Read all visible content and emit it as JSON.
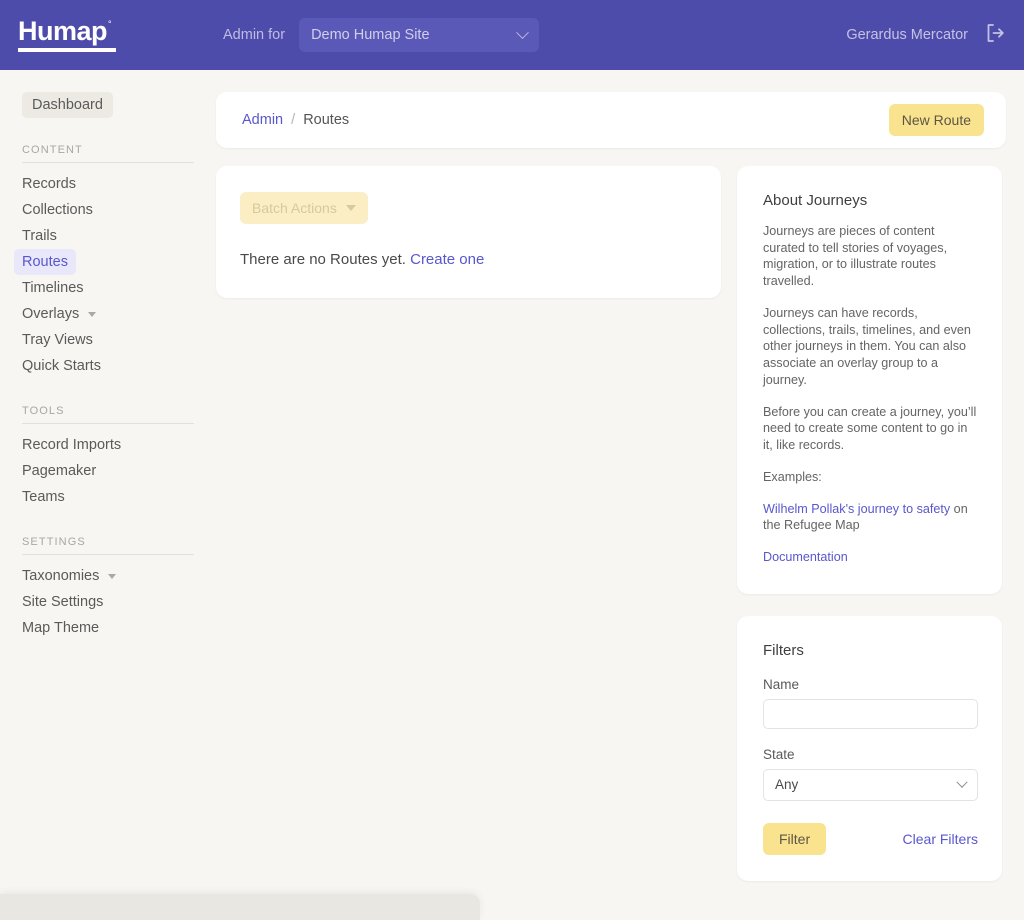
{
  "header": {
    "logo_text": "Humap",
    "logo_mark": "°",
    "admin_for_label": "Admin for",
    "site_value": "Demo Humap Site",
    "user_name": "Gerardus Mercator",
    "logout_icon": "sign-out-icon",
    "brand_color": "#4e4cab"
  },
  "sidebar": {
    "dashboard_label": "Dashboard",
    "groups": [
      {
        "label": "CONTENT",
        "items": [
          {
            "label": "Records",
            "active": false,
            "caret": false
          },
          {
            "label": "Collections",
            "active": false,
            "caret": false
          },
          {
            "label": "Trails",
            "active": false,
            "caret": false
          },
          {
            "label": "Routes",
            "active": true,
            "caret": false
          },
          {
            "label": "Timelines",
            "active": false,
            "caret": false
          },
          {
            "label": "Overlays",
            "active": false,
            "caret": true
          },
          {
            "label": "Tray Views",
            "active": false,
            "caret": false
          },
          {
            "label": "Quick Starts",
            "active": false,
            "caret": false
          }
        ]
      },
      {
        "label": "TOOLS",
        "items": [
          {
            "label": "Record Imports",
            "active": false,
            "caret": false
          },
          {
            "label": "Pagemaker",
            "active": false,
            "caret": false
          },
          {
            "label": "Teams",
            "active": false,
            "caret": false
          }
        ]
      },
      {
        "label": "SETTINGS",
        "items": [
          {
            "label": "Taxonomies",
            "active": false,
            "caret": true
          },
          {
            "label": "Site Settings",
            "active": false,
            "caret": false
          },
          {
            "label": "Map Theme",
            "active": false,
            "caret": false
          }
        ]
      }
    ]
  },
  "breadcrumb": {
    "root_label": "Admin",
    "separator": "/",
    "current_label": "Routes",
    "new_button_label": "New Route"
  },
  "list_panel": {
    "batch_actions_label": "Batch Actions",
    "empty_text": "There are no Routes yet.",
    "empty_link": "Create one"
  },
  "about_panel": {
    "title": "About Journeys",
    "paragraph_1": "Journeys are pieces of content curated to tell stories of voyages, migration, or to illustrate routes travelled.",
    "paragraph_2": "Journeys can have records, collections, trails, timelines, and even other journeys in them. You can also associate an overlay group to a journey.",
    "paragraph_3": "Before you can create a journey, you’ll need to create some content to go in it, like records.",
    "examples_label": "Examples:",
    "example_link": "Wilhelm Pollak's journey to safety",
    "example_suffix": " on the Refugee Map",
    "documentation_link": "Documentation"
  },
  "filters_panel": {
    "title": "Filters",
    "name_label": "Name",
    "name_value": "",
    "name_placeholder": "",
    "state_label": "State",
    "state_value": "Any",
    "filter_button_label": "Filter",
    "clear_link_label": "Clear Filters"
  },
  "colors": {
    "accent_yellow": "#fae38e",
    "accent_purple": "#5957cd",
    "page_background": "#f7f6f2"
  }
}
